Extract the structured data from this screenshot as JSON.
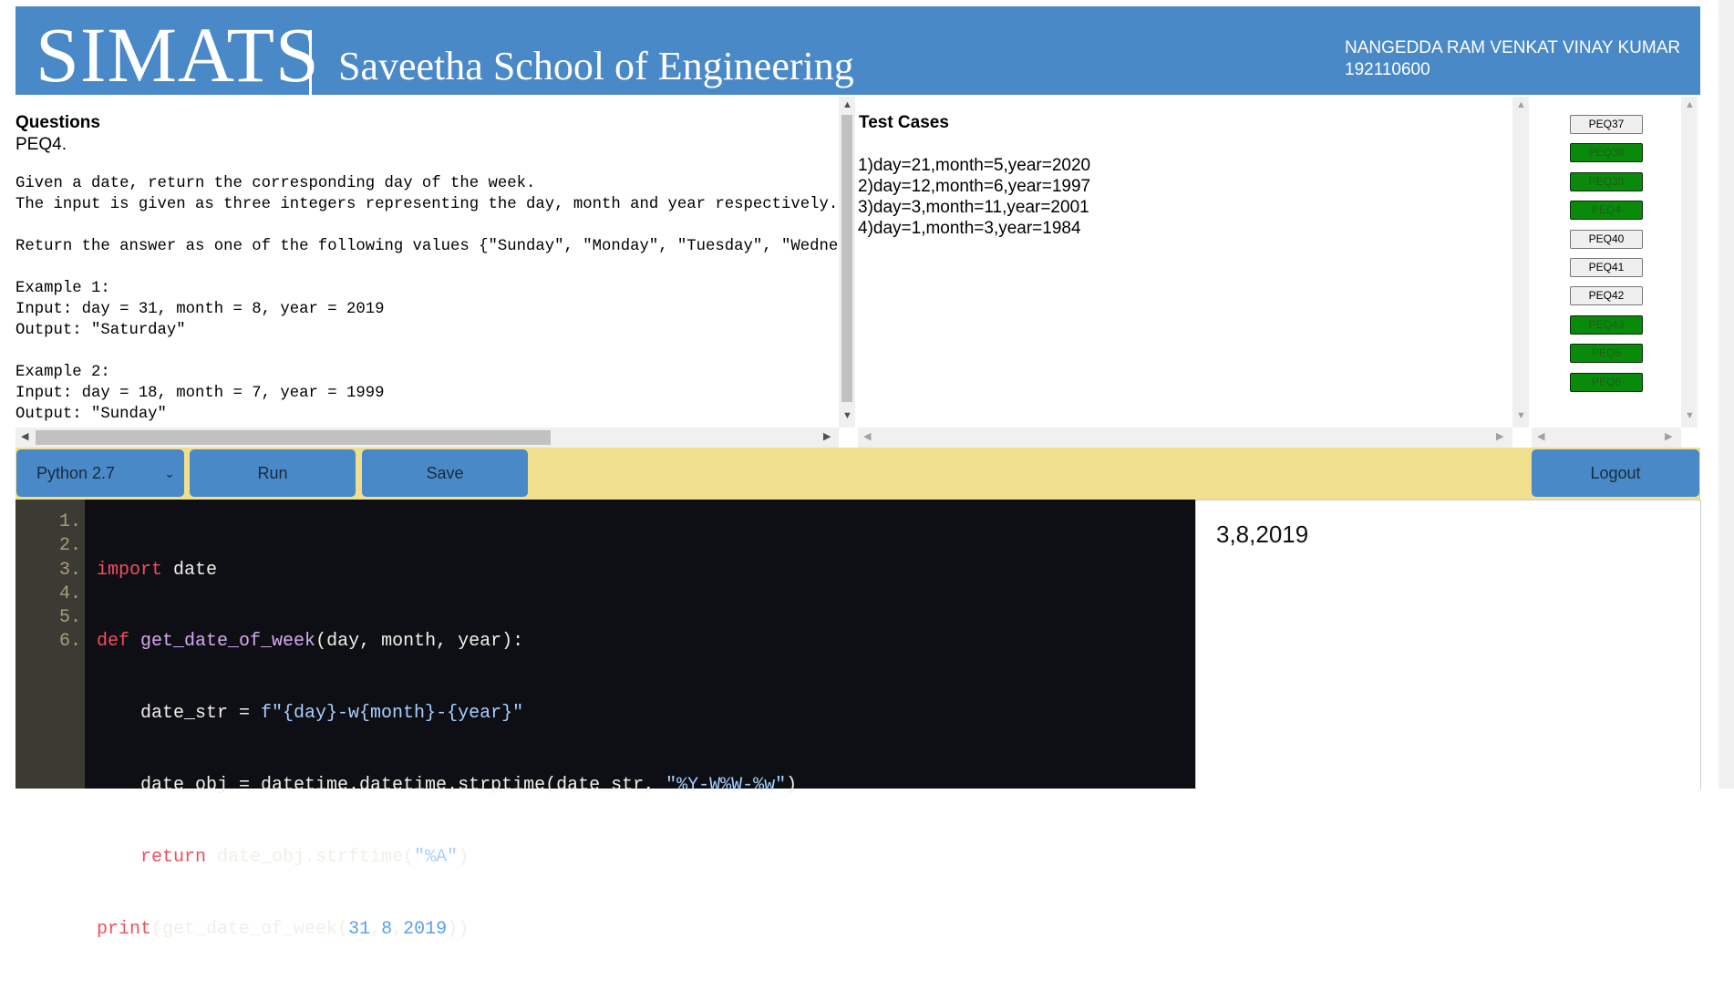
{
  "header": {
    "logo": "SIMATS",
    "school": "Saveetha School of Engineering",
    "user_name": "NANGEDDA RAM VENKAT VINAY KUMAR",
    "user_id": "192110600"
  },
  "question": {
    "title": "Questions",
    "id": "PEQ4.",
    "body": "Given a date, return the corresponding day of the week.\nThe input is given as three integers representing the day, month and year respectively.\n\nReturn the answer as one of the following values {\"Sunday\", \"Monday\", \"Tuesday\", \"Wednesday\", \"Thursday\", \"Friday\", \"Saturday\"}.\n\nExample 1:\nInput: day = 31, month = 8, year = 2019\nOutput: \"Saturday\"\n\nExample 2:\nInput: day = 18, month = 7, year = 1999\nOutput: \"Sunday\""
  },
  "test_cases": {
    "title": "Test Cases",
    "items": [
      "1)day=21,month=5,year=2020",
      "2)day=12,month=6,year=1997",
      "3)day=3,month=11,year=2001",
      "4)day=1,month=3,year=1984"
    ]
  },
  "problems": [
    {
      "label": "PEQ37",
      "status": "pending"
    },
    {
      "label": "PEQ38",
      "status": "done"
    },
    {
      "label": "PEQ39",
      "status": "done"
    },
    {
      "label": "PEQ4",
      "status": "done"
    },
    {
      "label": "PEQ40",
      "status": "pending"
    },
    {
      "label": "PEQ41",
      "status": "pending"
    },
    {
      "label": "PEQ42",
      "status": "pending"
    },
    {
      "label": "PEQ43",
      "status": "done"
    },
    {
      "label": "PEQ5",
      "status": "done"
    },
    {
      "label": "PEQ6",
      "status": "done"
    }
  ],
  "toolbar": {
    "language": "Python 2.7",
    "run_label": "Run",
    "save_label": "Save",
    "logout_label": "Logout"
  },
  "editor": {
    "line_numbers": [
      "1.",
      "2.",
      "3.",
      "4.",
      "5.",
      "6."
    ],
    "lines": [
      "import date",
      "def get_date_of_week(day, month, year):",
      "    date_str = f\"{day}-w{month}-{year}\"",
      "    date_obj = datetime.datetime.strptime(date_str, \"%Y-W%W-%w\")",
      "    return date_obj.strftime(\"%A\")",
      "print(get_date_of_week(31,8,2019))"
    ]
  },
  "output": {
    "text": "3,8,2019"
  },
  "colors": {
    "header_bg": "#4a89c8",
    "toolbar_bg": "#f0df8c",
    "done": "#0a8a0a",
    "editor_bg": "#0d0f14",
    "keyword": "#f0505a",
    "function": "#d8a8f0",
    "string": "#a8d0ff",
    "number": "#5a9ff0"
  }
}
